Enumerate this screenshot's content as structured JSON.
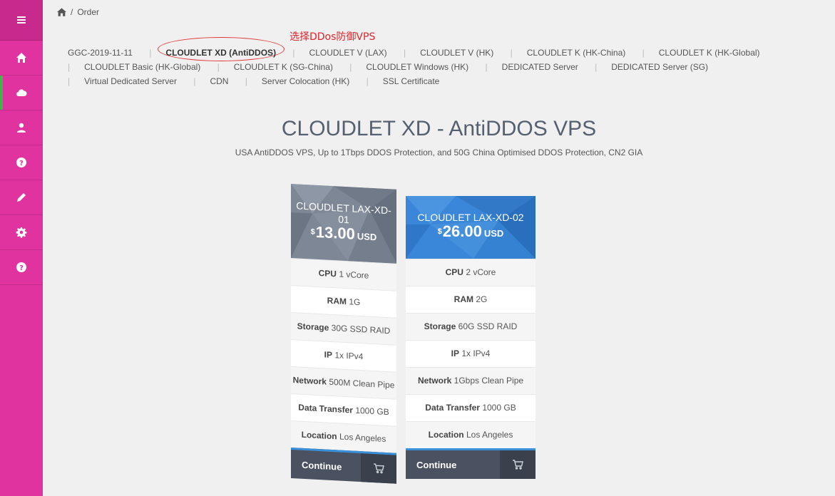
{
  "sidebar": {
    "items": [
      {
        "icon": "hamburger-menu-icon"
      },
      {
        "icon": "home-icon"
      },
      {
        "icon": "cloud-icon"
      },
      {
        "icon": "user-icon"
      },
      {
        "icon": "help-icon"
      },
      {
        "icon": "pencil-icon"
      },
      {
        "icon": "gear-icon"
      },
      {
        "icon": "help-icon"
      }
    ],
    "colors": {
      "background": "#e0339f",
      "active_indicator": "#44b34a"
    }
  },
  "breadcrumb": {
    "home_icon": "home-icon",
    "separator": "/",
    "current": "Order"
  },
  "annotation": {
    "text": "选择DDos防御VPS",
    "color": "#e0242a"
  },
  "categories": [
    {
      "label": "GGC-2019-11-11",
      "active": false
    },
    {
      "label": "CLOUDLET XD (AntiDDOS)",
      "active": true
    },
    {
      "label": "CLOUDLET V (LAX)",
      "active": false
    },
    {
      "label": "CLOUDLET V (HK)",
      "active": false
    },
    {
      "label": "CLOUDLET K (HK-China)",
      "active": false
    },
    {
      "label": "CLOUDLET K (HK-Global)",
      "active": false
    },
    {
      "label": "CLOUDLET Basic (HK-Global)",
      "active": false
    },
    {
      "label": "CLOUDLET K (SG-China)",
      "active": false
    },
    {
      "label": "CLOUDLET Windows (HK)",
      "active": false
    },
    {
      "label": "DEDICATED Server",
      "active": false
    },
    {
      "label": "DEDICATED Server (SG)",
      "active": false
    },
    {
      "label": "Virtual Dedicated Server",
      "active": false
    },
    {
      "label": "CDN",
      "active": false
    },
    {
      "label": "Server Colocation (HK)",
      "active": false
    },
    {
      "label": "SSL Certificate",
      "active": false
    }
  ],
  "page": {
    "title": "CLOUDLET XD - AntiDDOS VPS",
    "subtitle": "USA AntiDDOS VPS, Up to 1Tbps DDOS Protection, and 50G China Optimised DDOS Protection, CN2 GIA"
  },
  "products": [
    {
      "name": "CLOUDLET LAX-XD-01",
      "currency_symbol": "$",
      "price": "13.00",
      "currency": "USD",
      "features": [
        {
          "label": "CPU",
          "value": "1 vCore"
        },
        {
          "label": "RAM",
          "value": "1G"
        },
        {
          "label": "Storage",
          "value": "30G SSD RAID"
        },
        {
          "label": "IP",
          "value": "1x IPv4"
        },
        {
          "label": "Network",
          "value": "500M Clean Pipe"
        },
        {
          "label": "Data Transfer",
          "value": "1000 GB"
        },
        {
          "label": "Location",
          "value": "Los Angeles"
        }
      ],
      "button": "Continue",
      "cart_icon": "cart-icon"
    },
    {
      "name": "CLOUDLET LAX-XD-02",
      "currency_symbol": "$",
      "price": "26.00",
      "currency": "USD",
      "features": [
        {
          "label": "CPU",
          "value": "2 vCore"
        },
        {
          "label": "RAM",
          "value": "2G"
        },
        {
          "label": "Storage",
          "value": "60G SSD RAID"
        },
        {
          "label": "IP",
          "value": "1x IPv4"
        },
        {
          "label": "Network",
          "value": "1Gbps Clean Pipe"
        },
        {
          "label": "Data Transfer",
          "value": "1000 GB"
        },
        {
          "label": "Location",
          "value": "Los Angeles"
        }
      ],
      "button": "Continue",
      "cart_icon": "cart-icon"
    }
  ]
}
